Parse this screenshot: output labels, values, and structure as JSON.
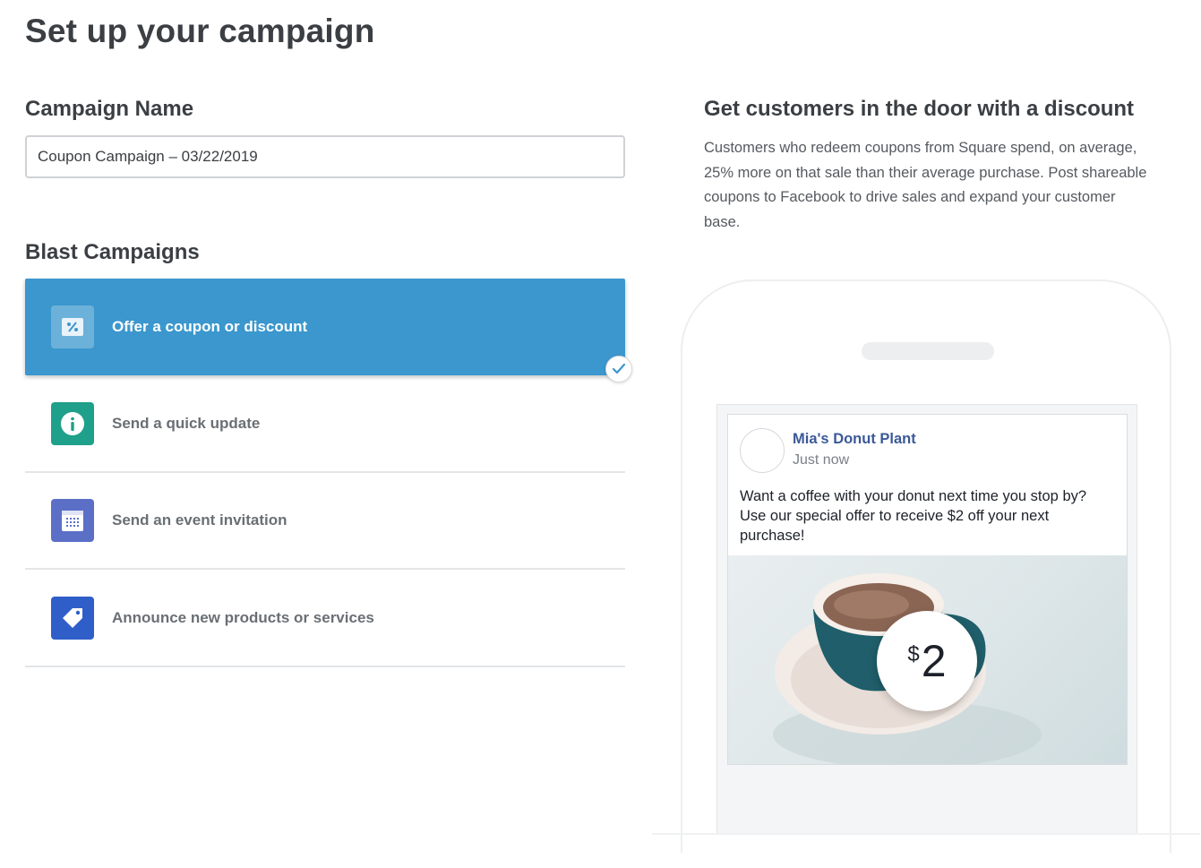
{
  "page": {
    "title": "Set up your campaign"
  },
  "campaign_name": {
    "label": "Campaign Name",
    "value": "Coupon Campaign – 03/22/2019"
  },
  "blast": {
    "label": "Blast Campaigns",
    "options": [
      {
        "label": "Offer a coupon or discount",
        "icon": "percent-coupon-icon",
        "color": "#3b97cd",
        "selected": true
      },
      {
        "label": "Send a quick update",
        "icon": "info-icon",
        "color": "#1fa08a",
        "selected": false
      },
      {
        "label": "Send an event invitation",
        "icon": "calendar-icon",
        "color": "#5b6fc7",
        "selected": false
      },
      {
        "label": "Announce new products or services",
        "icon": "tag-icon",
        "color": "#2f5ec8",
        "selected": false
      }
    ]
  },
  "promo": {
    "title": "Get customers in the door with a discount",
    "description": "Customers who redeem coupons from Square spend, on average, 25% more on that sale than their average purchase. Post shareable coupons to Facebook to drive sales and expand your customer base."
  },
  "preview": {
    "author": "Mia's Donut Plant",
    "time": "Just now",
    "message": "Want a coffee with your donut next time you stop by? Use our special offer to receive $2 off your next purchase!",
    "price_currency": "$",
    "price_amount": "2"
  }
}
